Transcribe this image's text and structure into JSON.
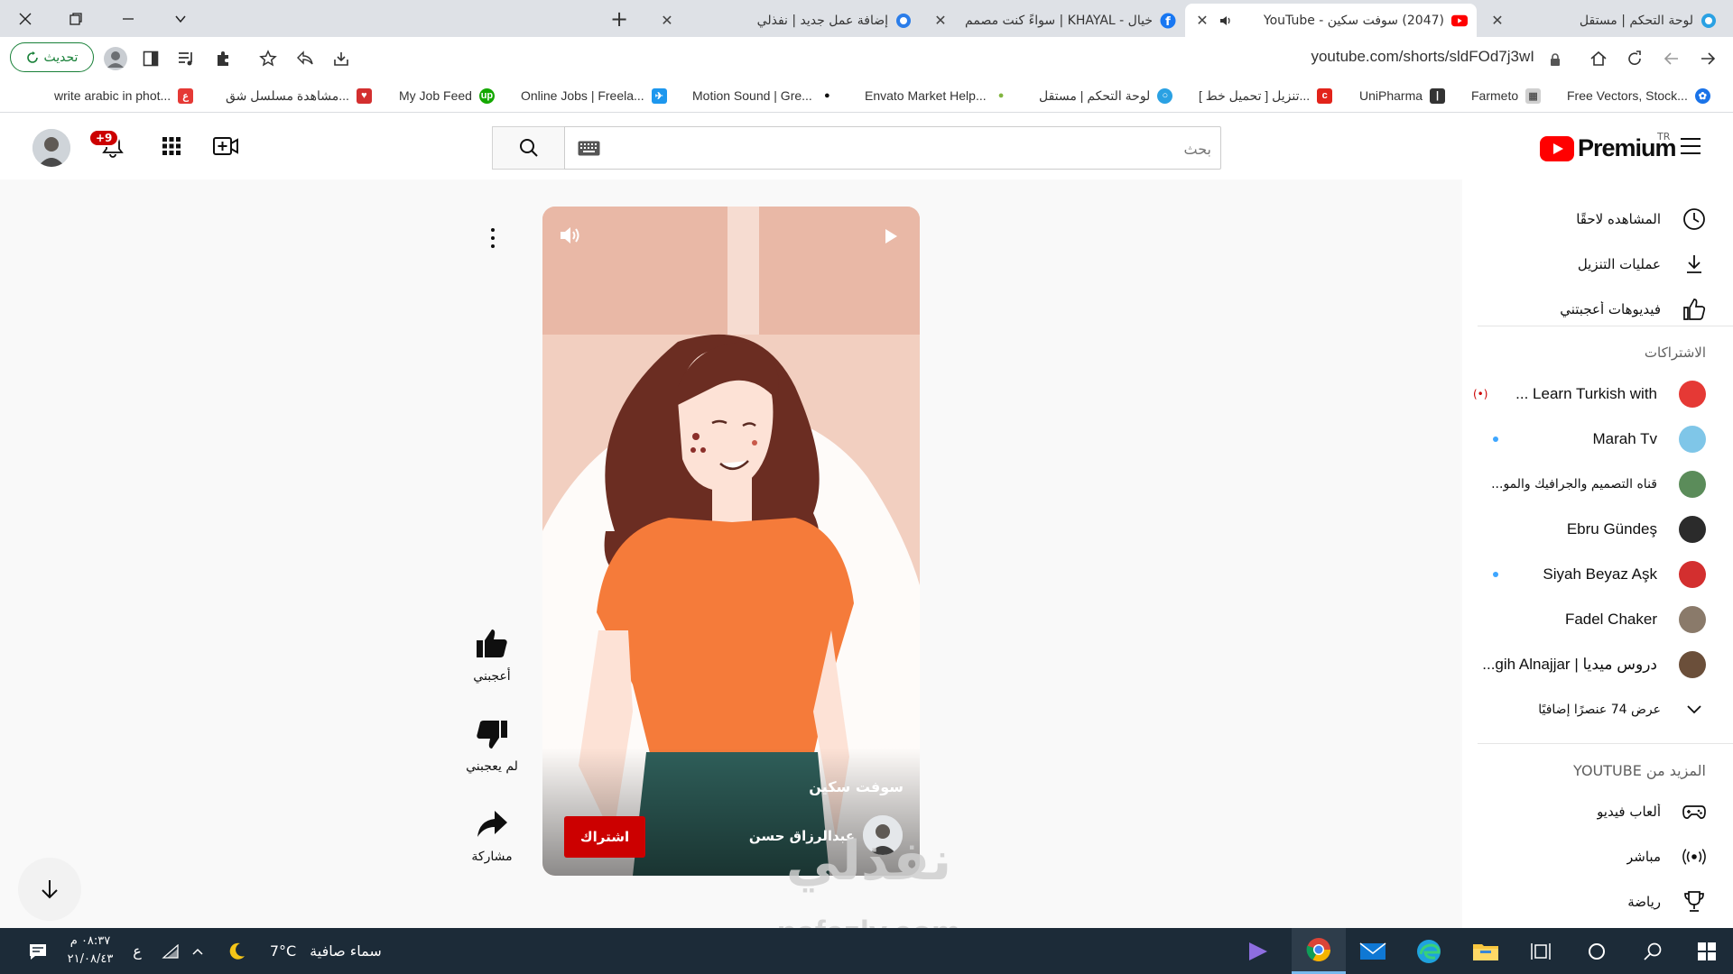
{
  "browser": {
    "tabs": [
      {
        "title": "لوحة التحكم | مستقل",
        "active": false
      },
      {
        "title": "(2047) سوفت سكين - YouTube",
        "active": true
      },
      {
        "title": "خيال - KHAYAL | سواءً كنت مصمم",
        "active": false
      },
      {
        "title": "إضافة عمل جديد | نفذلي",
        "active": false
      }
    ],
    "url": "youtube.com/shorts/sldFOd7j3wI",
    "update_label": "تحديث",
    "bookmarks": [
      {
        "label": "Free Vectors, Stock...",
        "color": "#1a73e8"
      },
      {
        "label": "Farmeto",
        "color": "#b0b0b0"
      },
      {
        "label": "UniPharma",
        "color": "#333333"
      },
      {
        "label": "[ تحميل خط ] تنزيل...",
        "color": "#e2231a"
      },
      {
        "label": "لوحة التحكم | مستقل",
        "color": "#2aa1e3"
      },
      {
        "label": "Envato Market Help...",
        "color": "#82b540"
      },
      {
        "label": "Motion Sound | Gre...",
        "color": "#111111"
      },
      {
        "label": "Online Jobs | Freela...",
        "color": "#1d97ee"
      },
      {
        "label": "My Job Feed",
        "color": "#14a800"
      },
      {
        "label": "مشاهدة مسلسل شق...",
        "color": "#d32f2f"
      },
      {
        "label": "write arabic in phot...",
        "color": "#e53935"
      }
    ]
  },
  "yt": {
    "logo_text": "Premium",
    "logo_region": "TR",
    "search_placeholder": "بحث",
    "notif_count": "+9",
    "sidebar": {
      "top_items": [
        "المشاهده لاحقًا",
        "عمليات التنزيل",
        "فيديوهات أعجبتني"
      ],
      "subs_heading": "الاشتراكات",
      "subscriptions": [
        {
          "name": "Learn Turkish with ...",
          "color": "#e53935",
          "live": true
        },
        {
          "name": "Marah Tv",
          "color": "#7fc6e8",
          "dot": true
        },
        {
          "name": "قناه التصميم والجرافيك والمو...",
          "color": "#5b8c5a"
        },
        {
          "name": "Ebru Gündeş",
          "color": "#2b2b2b"
        },
        {
          "name": "Siyah Beyaz Aşk",
          "color": "#d32f2f",
          "dot": true
        },
        {
          "name": "Fadel Chaker",
          "color": "#8a7a6a"
        },
        {
          "name": "دروس ميديا | gih Alnajjar...",
          "color": "#6b4f3a"
        }
      ],
      "show_more": "عرض 74 عنصرًا إضافيًا",
      "more_heading": "المزيد من YOUTUBE",
      "more_items": [
        "ألعاب فيديو",
        "مباشر",
        "رياضة"
      ]
    },
    "short": {
      "title": "سوفت سكين",
      "channel": "عبدالرزاق حسن",
      "subscribe": "اشتراك",
      "like": "أعجبني",
      "dislike": "لم يعجبني",
      "share": "مشاركة"
    },
    "watermark_text": "نفذلي",
    "watermark_url": "nafezly.com"
  },
  "taskbar": {
    "weather_text": "سماء صافية",
    "temperature": "7°C",
    "lang": "ع",
    "time": "٠٨:٣٧ م",
    "date": "٢١/٠٨/٤٣"
  }
}
